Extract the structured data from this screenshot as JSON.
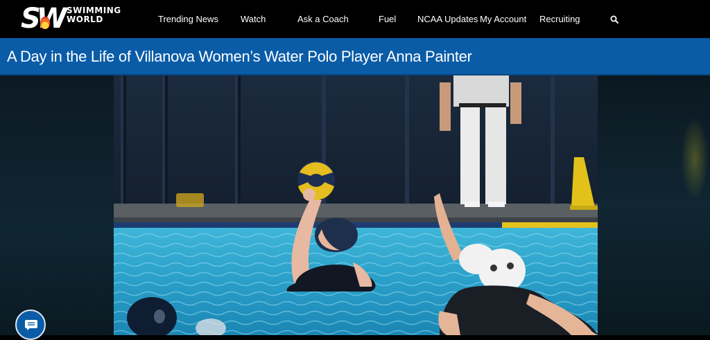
{
  "brand": {
    "line1": "SWIMMING",
    "line2": "WORLD",
    "mark": "SW"
  },
  "nav": {
    "items": [
      {
        "label": "Trending News"
      },
      {
        "label": "Watch"
      },
      {
        "label": "Ask a Coach"
      },
      {
        "label": "Fuel"
      },
      {
        "label": "NCAA Updates"
      },
      {
        "label": "My Account"
      },
      {
        "label": "Recruiting"
      }
    ],
    "search_icon": "search-icon"
  },
  "article": {
    "title": "A Day in the Life of Villanova Women’s Water Polo Player Anna Painter",
    "image_alt": "water-polo-player-photo"
  },
  "chat": {
    "icon": "chat-bubble-icon"
  },
  "colors": {
    "header_bg": "#000000",
    "title_bar": "#0a5ca7",
    "pool": "#2fa6c9"
  }
}
